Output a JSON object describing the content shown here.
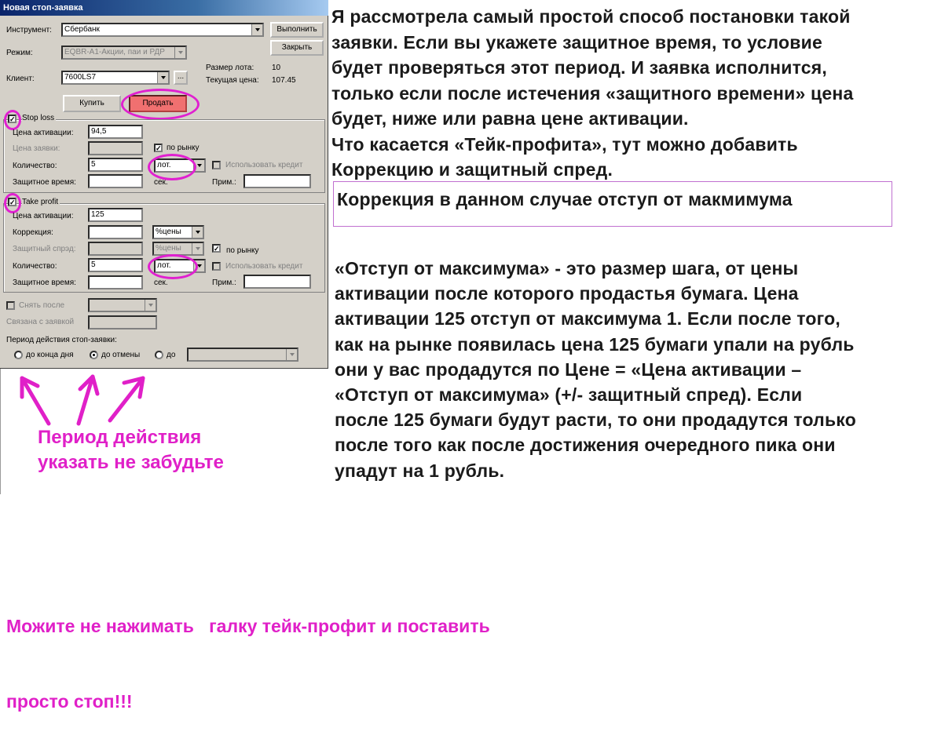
{
  "dialog": {
    "title": "Новая стоп-заявка",
    "instrument_label": "Инструмент:",
    "instrument_value": "Сбербанк",
    "execute_button": "Выполнить",
    "close_button": "Закрыть",
    "mode_label": "Режим:",
    "mode_value": "EQBR-A1-Акции, паи и РДР",
    "lot_size_label": "Размер лота:",
    "lot_size_value": "10",
    "client_label": "Клиент:",
    "client_value": "7600LS7",
    "browse_button": "...",
    "current_price_label": "Текущая цена:",
    "current_price_value": "107.45",
    "buy_button": "Купить",
    "sell_button": "Продать",
    "stop_loss": {
      "checkbox_label": "Stop loss",
      "activation_price_label": "Цена активации:",
      "activation_price_value": "94,5",
      "order_price_label": "Цена заявки:",
      "order_price_value": "",
      "market_label": "по рынку",
      "quantity_label": "Количество:",
      "quantity_value": "5",
      "unit_value": "лот.",
      "use_credit_label": "Использовать кредит",
      "protect_time_label": "Защитное время:",
      "protect_time_value": "",
      "sec_label": "сек.",
      "note_label": "Прим.:",
      "note_value": ""
    },
    "take_profit": {
      "checkbox_label": "Take profit",
      "activation_price_label": "Цена активации:",
      "activation_price_value": "125",
      "correction_label": "Коррекция:",
      "correction_value": "",
      "correction_unit": "%цены",
      "protect_spread_label": "Защитный спрэд:",
      "protect_spread_value": "",
      "protect_spread_unit": "%цены",
      "market_label": "по рынку",
      "quantity_label": "Количество:",
      "quantity_value": "5",
      "unit_value": "лот.",
      "use_credit_label": "Использовать кредит",
      "protect_time_label": "Защитное время:",
      "protect_time_value": "",
      "sec_label": "сек.",
      "note_label": "Прим.:",
      "note_value": ""
    },
    "cancel_after_label": "Снять после",
    "linked_label": "Связана с заявкой",
    "period_label": "Период действия стоп-заявки:",
    "period_end_of_day": "до конца дня",
    "period_until_cancel": "до отмены",
    "period_until": "до"
  },
  "annotations": {
    "right_lines": [
      "Я рассмотрела самый простой способ постановки такой",
      "заявки. Если вы укажете защитное время, то условие",
      "будет проверяться этот период. И заявка исполнится,",
      "только если после истечения «защитного времени» цена",
      "будет, ниже или равна цене активации.",
      "Что касается «Тейк-профита», тут можно добавить",
      "Коррекцию и защитный спред."
    ],
    "boxed_note": "Коррекция в данном случае отступ от макмимума",
    "explain_lines": [
      "«Отступ от максимума» - это размер шага, от цены",
      "активации после которого продастья бумага. Цена",
      "активации 125 отступ от максимума 1. Если после того,",
      "как на рынке появилась цена 125 бумаги упали на рубль",
      "они у вас продадутся по Цене = «Цена активации –",
      "«Отступ от максимума» (+/- защитный спред). Если",
      "после 125 бумаги будут расти, то они продадутся только",
      "после того как после достижения очередного пика они",
      "упадут на 1 рубль."
    ],
    "period_reminder_lines": [
      "Период действия",
      "указать не забудьте"
    ],
    "bottom_lines": [
      "Можите не нажимать   галку тейк-профит и поставить",
      "просто стоп!!!"
    ]
  },
  "colors": {
    "annotation_pink": "#e020c8",
    "title_bar": "#0a246a",
    "sell_button": "#f07070"
  }
}
